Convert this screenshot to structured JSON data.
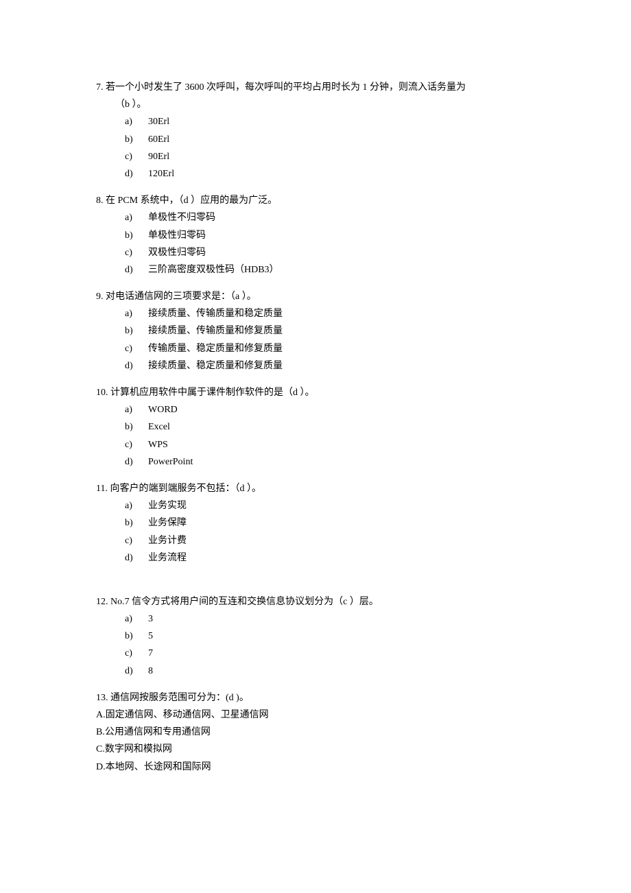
{
  "questions": [
    {
      "num": "7.",
      "stem_line1": "若一个小时发生了 3600 次呼叫，每次呼叫的平均占用时长为 1 分钟，则流入话务量为",
      "stem_line2": "（b ）。",
      "opts": [
        {
          "l": "a)",
          "t": "30Erl"
        },
        {
          "l": "b)",
          "t": "60Erl"
        },
        {
          "l": "c)",
          "t": "90Erl"
        },
        {
          "l": "d)",
          "t": "120Erl"
        }
      ]
    },
    {
      "num": "8.",
      "stem_line1": "在 PCM 系统中，（d ）应用的最为广泛。",
      "opts": [
        {
          "l": "a)",
          "t": "单极性不归零码"
        },
        {
          "l": "b)",
          "t": "单极性归零码"
        },
        {
          "l": "c)",
          "t": "双极性归零码"
        },
        {
          "l": "d)",
          "t": "三阶高密度双极性码（HDB3）"
        }
      ]
    },
    {
      "num": "9.",
      "stem_line1": "对电话通信网的三项要求是：（a ）。",
      "opts": [
        {
          "l": "a)",
          "t": "接续质量、传输质量和稳定质量"
        },
        {
          "l": "b)",
          "t": "接续质量、传输质量和修复质量"
        },
        {
          "l": "c)",
          "t": "传输质量、稳定质量和修复质量"
        },
        {
          "l": "d)",
          "t": "接续质量、稳定质量和修复质量"
        }
      ]
    },
    {
      "num": "10.",
      "stem_line1": "计算机应用软件中属于课件制作软件的是（d ）。",
      "opts": [
        {
          "l": "a)",
          "t": "WORD"
        },
        {
          "l": "b)",
          "t": "Excel"
        },
        {
          "l": "c)",
          "t": "WPS"
        },
        {
          "l": "d)",
          "t": "PowerPoint"
        }
      ]
    },
    {
      "num": "11.",
      "stem_line1": "向客户的端到端服务不包括：（d ）。",
      "opts": [
        {
          "l": "a)",
          "t": "业务实现"
        },
        {
          "l": "b)",
          "t": "业务保障"
        },
        {
          "l": "c)",
          "t": "业务计费"
        },
        {
          "l": "d)",
          "t": "业务流程"
        }
      ]
    },
    {
      "num": "12.",
      "stem_line1": "No.7 信令方式将用户间的互连和交换信息协议划分为（c ）层。",
      "opts": [
        {
          "l": "a)",
          "t": "3"
        },
        {
          "l": "b)",
          "t": "5"
        },
        {
          "l": "c)",
          "t": "7"
        },
        {
          "l": "d)",
          "t": "8"
        }
      ]
    },
    {
      "num": "13.",
      "stem_line1": "通信网按服务范围可分为：(d )。",
      "opts_alpha": [
        {
          "l": "A.",
          "t": "固定通信网、移动通信网、卫星通信网"
        },
        {
          "l": "B.",
          "t": "公用通信网和专用通信网"
        },
        {
          "l": "C.",
          "t": "数字网和模拟网"
        },
        {
          "l": "D.",
          "t": "本地网、长途网和国际网"
        }
      ]
    }
  ]
}
